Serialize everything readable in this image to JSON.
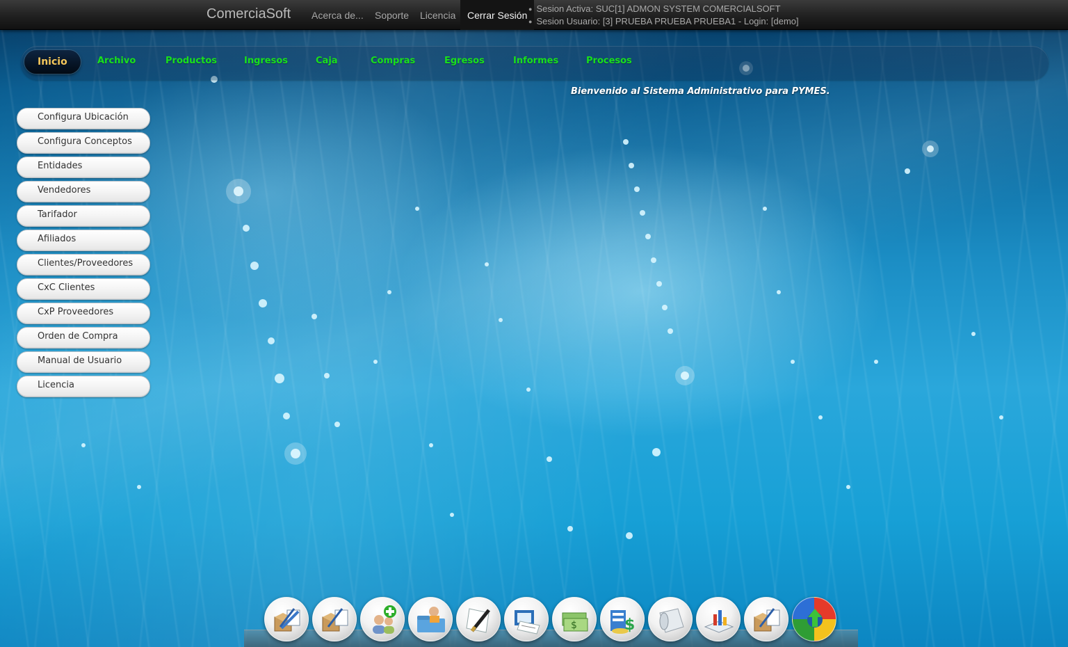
{
  "topbar": {
    "brand": "ComerciaSoft",
    "links": [
      "Acerca de...",
      "Soporte",
      "Licencia",
      "Cerrar Sesión"
    ],
    "active_link": "Cerrar Sesión",
    "session_active": "Sesion Activa: SUC[1] ADMON SYSTEM COMERCIALSOFT",
    "session_user": "Sesion Usuario: [3] PRUEBA PRUEBA PRUEBA1 - Login: [demo]"
  },
  "nav": {
    "items": [
      "Inicio",
      "Archivo",
      "Productos",
      "Ingresos",
      "Caja",
      "Compras",
      "Egresos",
      "Informes",
      "Procesos"
    ],
    "active": "Inicio",
    "active_color": "#f5c75b",
    "item_color": "#19e01d"
  },
  "welcome_text": "Bienvenido al Sistema Administrativo para PYMES.",
  "sidebar": {
    "items": [
      "Configura Ubicación",
      "Configura Conceptos",
      "Entidades",
      "Vendedores",
      "Tarifador",
      "Afiliados",
      "Clientes/Proveedores",
      "CxC Clientes",
      "CxP Proveedores",
      "Orden de Compra",
      "Manual de Usuario",
      "Licencia"
    ]
  },
  "dock": {
    "icons": [
      "box-edit-icon",
      "box-edit-icon",
      "add-user-icon",
      "user-folder-icon",
      "pen-document-icon",
      "invoice-printer-icon",
      "money-stack-icon",
      "cash-register-icon",
      "paper-roll-icon",
      "chart-report-icon",
      "box-edit-icon",
      "refresh-cycle-icon"
    ]
  }
}
